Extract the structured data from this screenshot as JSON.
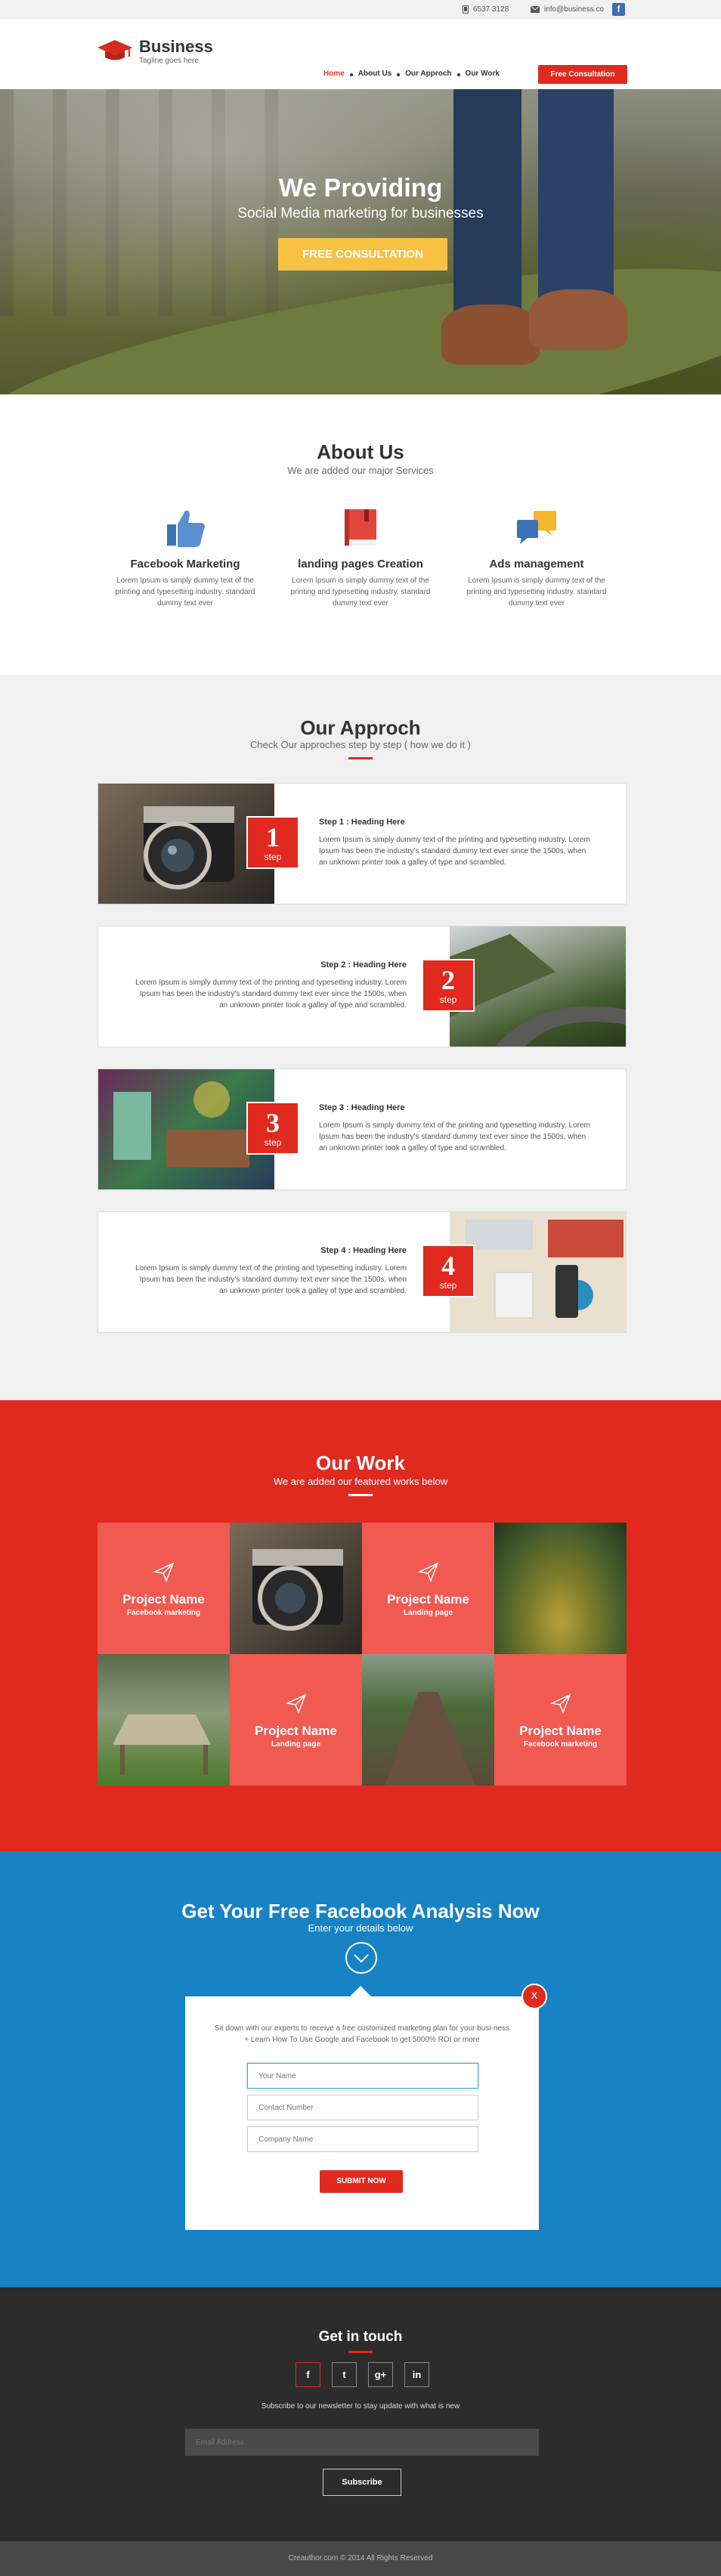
{
  "topbar": {
    "phone": "6537 3128",
    "email": "info@business.co",
    "fb": "f"
  },
  "header": {
    "logo_title": "Business",
    "logo_tagline": "Tagline goes here"
  },
  "nav": {
    "items": [
      "Home",
      "About Us",
      "Our Approch",
      "Our Work"
    ],
    "cta": "Free Consultation"
  },
  "hero": {
    "title": "We Providing",
    "subtitle": "Social Media marketing for businesses",
    "cta": "FREE CONSULTATION"
  },
  "about": {
    "title": "About Us",
    "subtitle": "We are added our major Services",
    "services": [
      {
        "title": "Facebook Marketing",
        "text": "Lorem Ipsum is simply dummy text of the printing and typesetting industry. standard dummy text ever",
        "icon": "thumbs-up-icon"
      },
      {
        "title": "landing pages Creation",
        "text": "Lorem Ipsum is simply dummy text of the printing and typesetting industry. standard dummy text ever",
        "icon": "book-icon"
      },
      {
        "title": "Ads management",
        "text": "Lorem Ipsum is simply dummy text of the printing and typesetting industry. standard dummy text ever",
        "icon": "chat-bubbles-icon"
      }
    ]
  },
  "approach": {
    "title": "Our Approch",
    "subtitle": "Check Our approches step by step ( how we do it )",
    "step_word": "step",
    "steps": [
      {
        "num": "1",
        "heading": "Step 1 : Heading Here",
        "text": "Lorem Ipsum is simply dummy text of the printing and typesetting industry. Lorem Ipsum has been the industry's standard dummy text ever since the 1500s, when an unknown printer took a galley of type and scrambled."
      },
      {
        "num": "2",
        "heading": "Step 2 : Heading Here",
        "text": "Lorem Ipsum is simply dummy text of the printing and typesetting industry. Lorem Ipsum has been the industry's standard dummy text ever since the 1500s, when an unknown printer took a galley of type and scrambled."
      },
      {
        "num": "3",
        "heading": "Step 3 : Heading Here",
        "text": "Lorem Ipsum is simply dummy text of the printing and typesetting industry. Lorem Ipsum has been the industry's standard dummy text ever since the 1500s, when an unknown printer took a galley of type and scrambled."
      },
      {
        "num": "4",
        "heading": "Step 4 : Heading Here",
        "text": "Lorem Ipsum is simply dummy text of the printing and typesetting industry. Lorem Ipsum has been the industry's standard dummy text ever since the 1500s, when an unknown printer took a galley of type and scrambled."
      }
    ]
  },
  "work": {
    "title": "Our Work",
    "subtitle": "We are added our featured works below",
    "projects": [
      {
        "name": "Project Name",
        "category": "Facebook marketing"
      },
      {
        "name": "Project Name",
        "category": "Landing page"
      },
      {
        "name": "Project Name",
        "category": "Landing page"
      },
      {
        "name": "Project Name",
        "category": "Facebook marketing"
      }
    ]
  },
  "analysis": {
    "title": "Get Your Free Facebook Analysis Now",
    "subtitle": "Enter your details below",
    "desc": "Sit down with our experts to receive a free customized marketing plan for your busi-ness + Learn How To Use Google and Facebook to get 5000% ROI or more",
    "close": "x",
    "name_placeholder": "Your Name",
    "number_placeholder": "Contact Number",
    "company_placeholder": "Company Name",
    "submit": "SUBMIT NOW"
  },
  "contact": {
    "title": "Get in touch",
    "social": [
      "f",
      "t",
      "g+",
      "in"
    ],
    "newsletter_text": "Subscribe to our newsletter to stay update with what is new",
    "email_placeholder": "Email Address",
    "subscribe": "Subscribe"
  },
  "footer": {
    "copyright": "Creauthor.com © 2014 All Rights Reserved"
  },
  "colors": {
    "accent": "#e02a1f",
    "blue": "#1783c4",
    "yellow": "#f7c243",
    "dark": "#2c2c2c"
  }
}
